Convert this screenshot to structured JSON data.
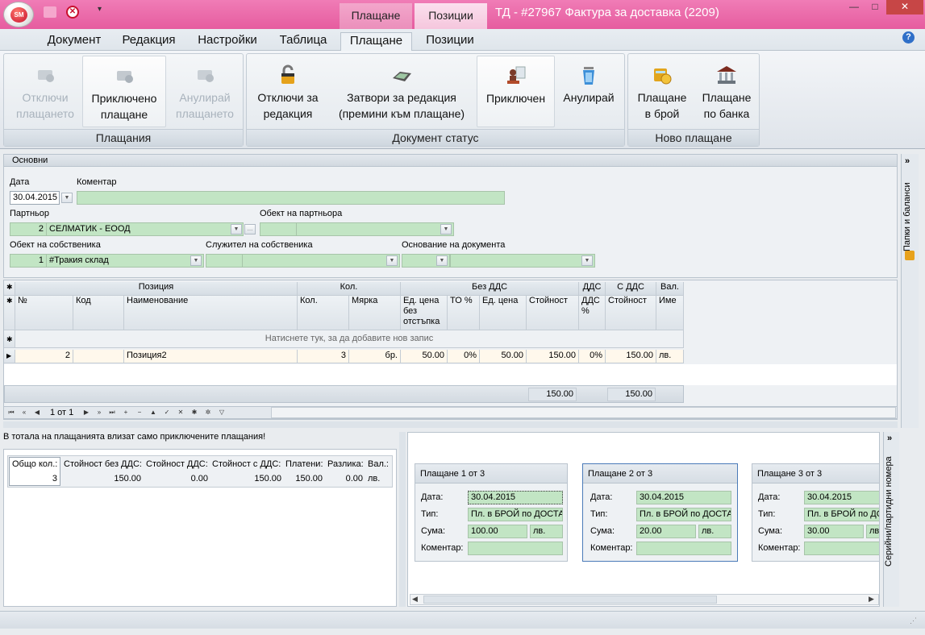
{
  "titlebar": {
    "app_logo": "SM",
    "title": "ТД - #27967 Фактура за доставка (2209)",
    "context_tabs": [
      "Плащане",
      "Позиции"
    ],
    "window_buttons": [
      "—",
      "□",
      "✕"
    ]
  },
  "tabs": [
    "Документ",
    "Редакция",
    "Настройки",
    "Таблица",
    "Плащане",
    "Позиции"
  ],
  "active_tab": "Плащане",
  "help_label": "?",
  "ribbon": {
    "groups": [
      {
        "label": "Плащания",
        "buttons": [
          {
            "label": "Отключи\nплащането",
            "icon": "unlock-payment-icon",
            "disabled": true
          },
          {
            "label": "Приключено\nплащане",
            "icon": "complete-payment-icon",
            "disabled": false,
            "selected": true
          },
          {
            "label": "Анулирай\nплащането",
            "icon": "cancel-payment-icon",
            "disabled": true
          }
        ]
      },
      {
        "label": "Документ статус",
        "buttons": [
          {
            "label": "Отключи за\nредакция",
            "icon": "padlock-icon"
          },
          {
            "label": "Затвори за редакция\n(премини към плащане)",
            "icon": "cash-register-icon"
          },
          {
            "label": "Приключен",
            "icon": "stamp-icon",
            "selected": true
          },
          {
            "label": "Анулирай",
            "icon": "trash-icon"
          }
        ]
      },
      {
        "label": "Ново плащане",
        "buttons": [
          {
            "label": "Плащане\nв брой",
            "icon": "cash-icon"
          },
          {
            "label": "Плащане\nпо банка",
            "icon": "bank-icon"
          }
        ]
      }
    ]
  },
  "basics": {
    "header": "Основни",
    "date_label": "Дата",
    "date_value": "30.04.2015",
    "comment_label": "Коментар",
    "comment_value": "",
    "partner_label": "Партньор",
    "partner_code": "2",
    "partner_name": "СЕЛМАТИК - ЕООД",
    "partner_object_label": "Обект на партньора",
    "owner_object_label": "Обект на собственика",
    "owner_object_code": "1",
    "owner_object_name": "#Тракия склад",
    "owner_employee_label": "Служител на собственика",
    "doc_reason_label": "Основание на документа"
  },
  "grid": {
    "bands": [
      "Позиция",
      "Кол.",
      "Без ДДС",
      "ДДС",
      "С ДДС",
      "Вал."
    ],
    "columns": [
      "№",
      "Код",
      "Наименование",
      "Кол.",
      "Мярка",
      "Ед. цена\nбез\nотстъпка",
      "ТО %",
      "Ед. цена",
      "Стойност",
      "ДДС\n%",
      "Стойност",
      "Име"
    ],
    "new_row_hint": "Натиснете тук, за да добавите нов запис",
    "rows": [
      {
        "no": "2",
        "code": "",
        "name": "Позиция2",
        "qty": "3",
        "unit": "бр.",
        "price_list": "50.00",
        "discount": "0%",
        "price": "50.00",
        "value": "150.00",
        "vat": "0%",
        "value_vat": "150.00",
        "currency": "лв."
      }
    ],
    "totals": {
      "value": "150.00",
      "value_vat": "150.00"
    },
    "navigator": {
      "record_text": "1 от 1"
    }
  },
  "payments_note": "В тотала на плащанията влизат само приключените плащания!",
  "summary": {
    "headers": [
      "Общо кол.:",
      "Стойност без ДДС:",
      "Стойност ДДС:",
      "Стойност с ДДС:",
      "Платени:",
      "Разлика:",
      "Вал.:"
    ],
    "values": [
      "3",
      "150.00",
      "0.00",
      "150.00",
      "150.00",
      "0.00",
      "лв."
    ]
  },
  "payments": [
    {
      "title": "Плащане 1 от 3",
      "date": "30.04.2015",
      "type": "Пл. в БРОЙ по ДОСТАВ",
      "amount": "100.00",
      "currency": "лв.",
      "comment": ""
    },
    {
      "title": "Плащане 2 от 3",
      "date": "30.04.2015",
      "type": "Пл. в БРОЙ по ДОСТАВ",
      "amount": "20.00",
      "currency": "лв.",
      "comment": ""
    },
    {
      "title": "Плащане 3 от 3",
      "date": "30.04.2015",
      "type": "Пл. в БРОЙ по ДОСТАВ",
      "amount": "30.00",
      "currency": "лв.",
      "comment": ""
    }
  ],
  "payment_labels": {
    "date": "Дата:",
    "type": "Тип:",
    "amount": "Сума:",
    "comment": "Коментар:"
  },
  "side_tabs": {
    "folders": "Папки и баланси",
    "serials": "Серийни/партидни номера"
  }
}
